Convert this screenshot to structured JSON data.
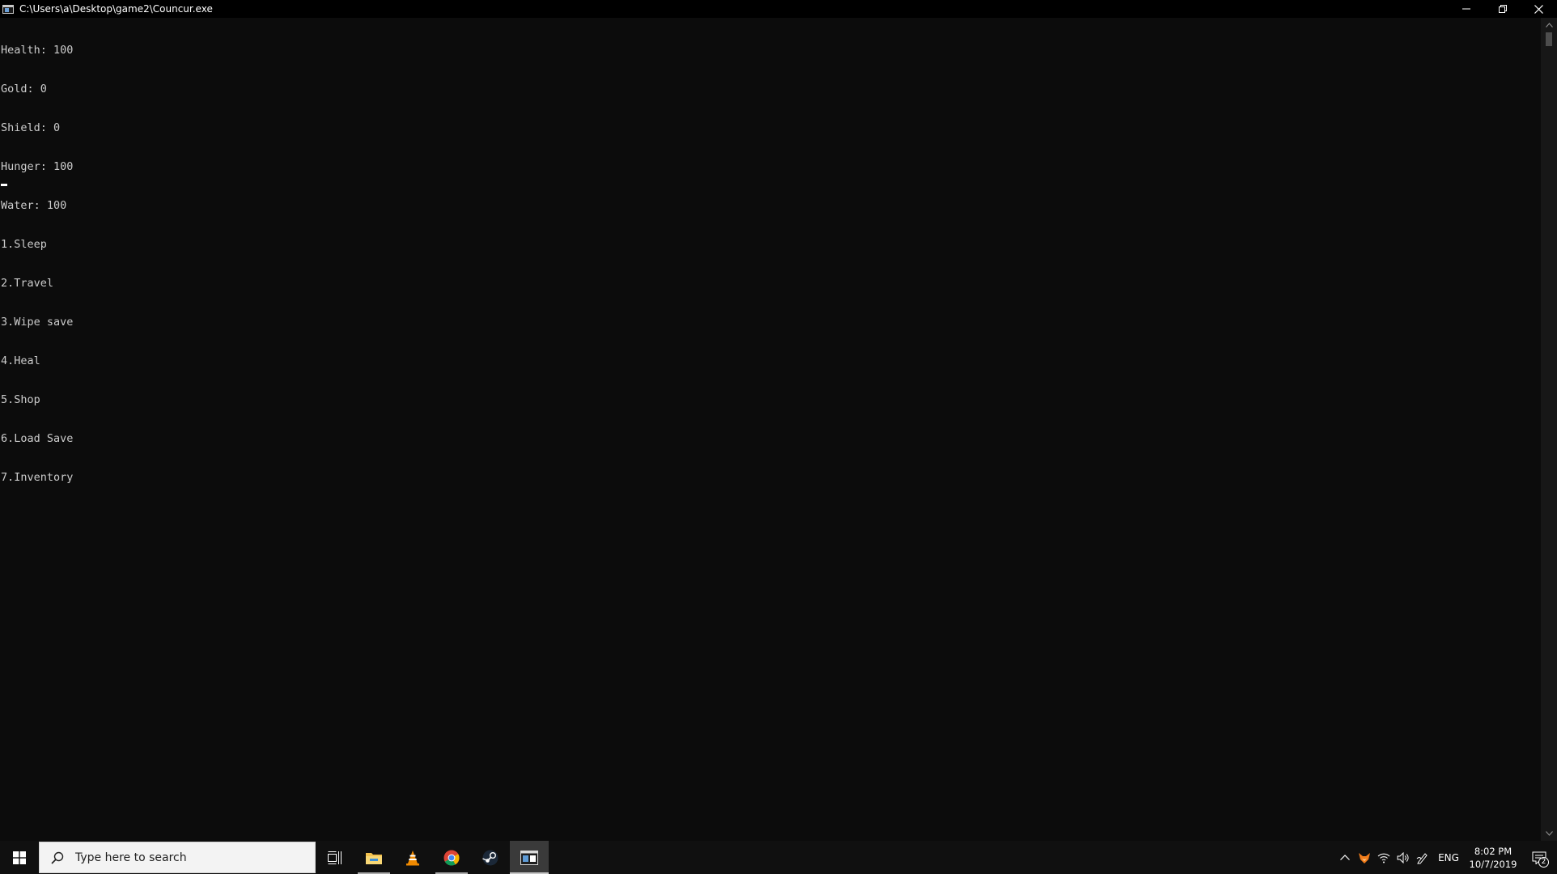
{
  "window": {
    "title": "C:\\Users\\a\\Desktop\\game2\\Councur.exe",
    "controls": {
      "minimize": "minimize-icon",
      "restore": "restore-icon",
      "close": "close-icon"
    }
  },
  "console": {
    "lines": [
      "Health: 100",
      "Gold: 0",
      "Shield: 0",
      "Hunger: 100",
      "Water: 100",
      "1.Sleep",
      "2.Travel",
      "3.Wipe save",
      "4.Heal",
      "5.Shop",
      "6.Load Save",
      "7.Inventory"
    ],
    "text_color": "#cccccc",
    "background": "#0c0c0c"
  },
  "taskbar": {
    "search_placeholder": "Type here to search",
    "apps": [
      {
        "name": "task-view",
        "icon": "task-view-icon"
      },
      {
        "name": "file-explorer",
        "icon": "folder-icon",
        "running": true
      },
      {
        "name": "vlc",
        "icon": "vlc-cone-icon"
      },
      {
        "name": "chrome",
        "icon": "chrome-icon",
        "running": true
      },
      {
        "name": "steam",
        "icon": "steam-icon"
      },
      {
        "name": "console",
        "icon": "console-window-icon",
        "active": true
      }
    ],
    "tray": {
      "language": "ENG",
      "time": "8:02 PM",
      "date": "10/7/2019",
      "notification_count": "2"
    }
  }
}
